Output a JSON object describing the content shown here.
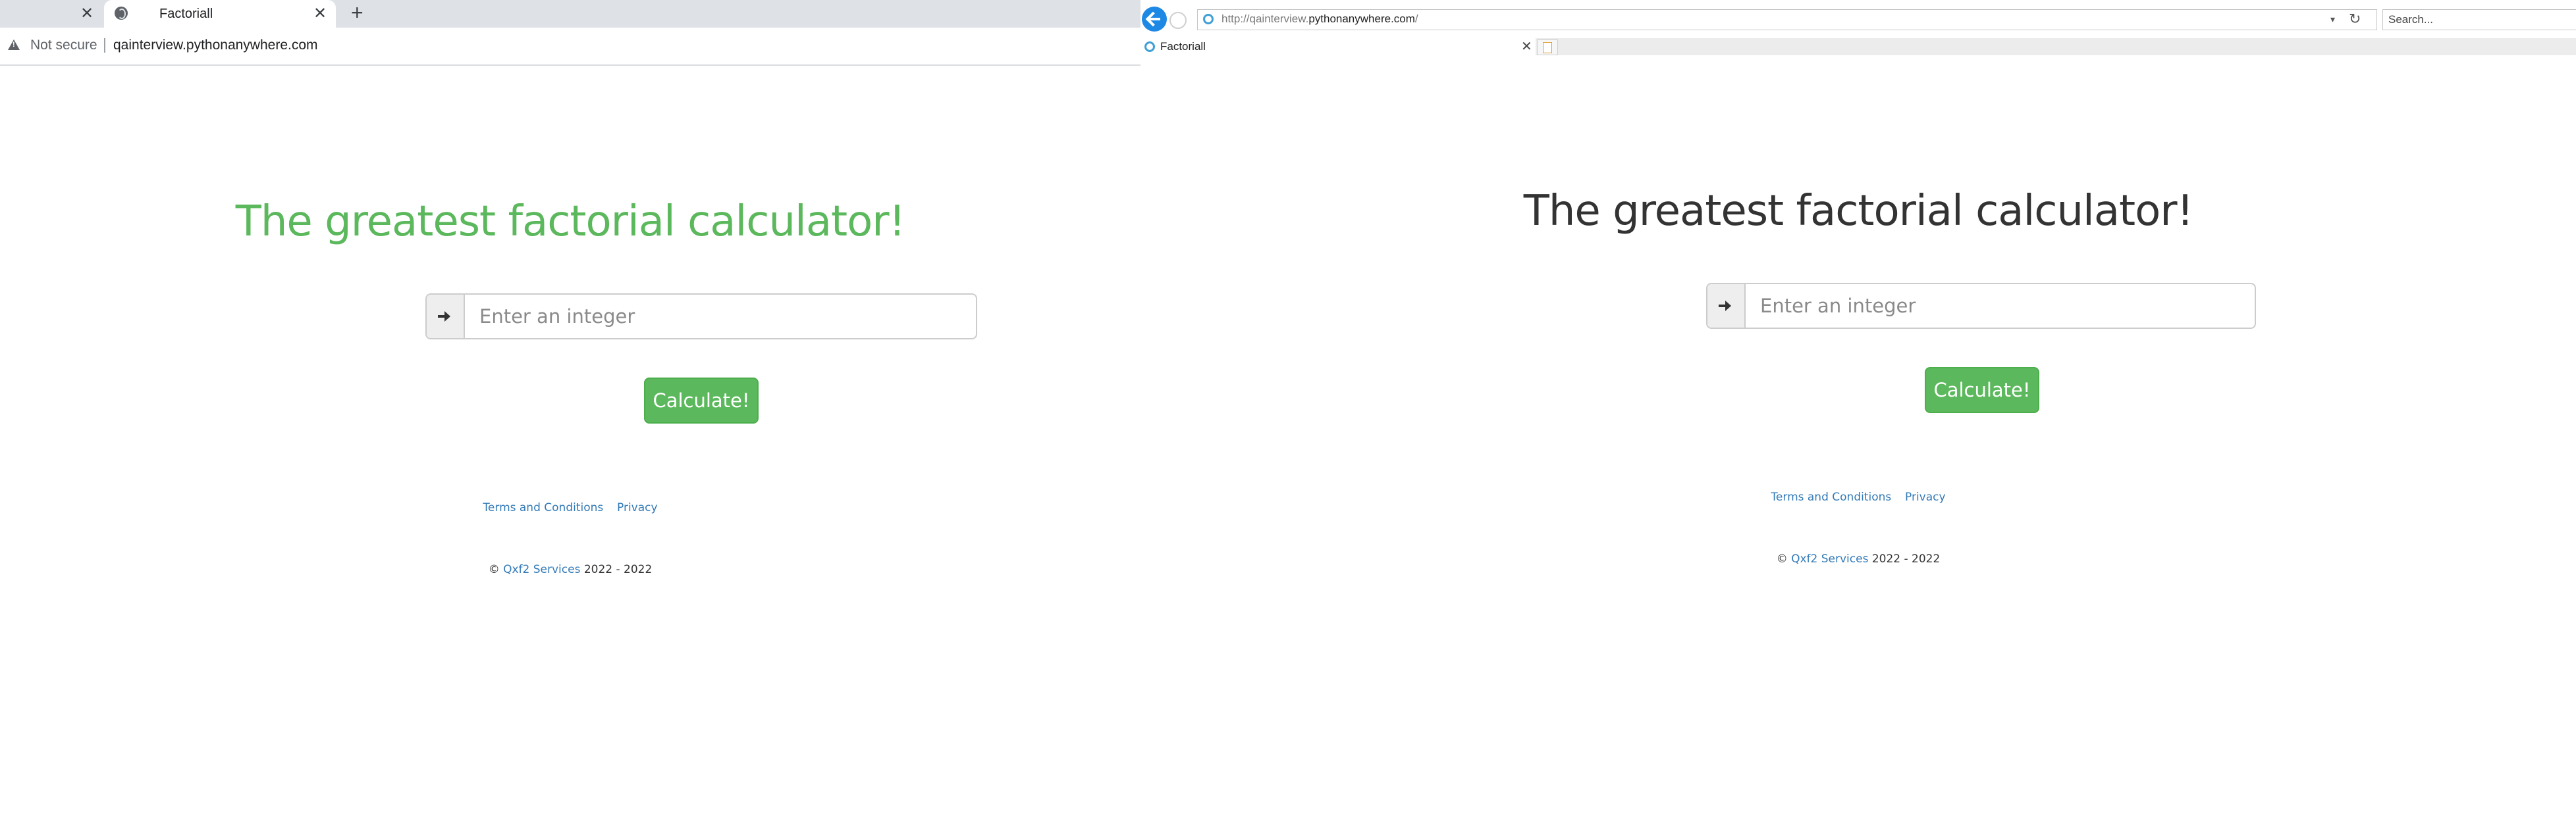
{
  "left_browser": {
    "tabs": [
      {
        "title": "",
        "active": false
      },
      {
        "title": "Factoriall",
        "active": true
      }
    ],
    "new_tab_symbol": "+",
    "close_symbol": "✕",
    "security_label": "Not secure",
    "url": "qainterview.pythonanywhere.com"
  },
  "right_browser": {
    "url_prefix": "http://qainterview.",
    "url_domain": "pythonanywhere.com",
    "url_suffix": "/",
    "search_placeholder": "Search...",
    "tab_title": "Factoriall",
    "close_symbol": "✕",
    "refresh_symbol": "↻",
    "dropdown_symbol": "▾"
  },
  "page": {
    "heading": "The greatest factorial calculator!",
    "input_placeholder": "Enter an integer",
    "input_value": "",
    "button_label": "Calculate!",
    "footer_links": [
      "Terms and Conditions",
      "Privacy"
    ],
    "copyright_prefix": "© ",
    "copyright_company": "Qxf2 Services",
    "copyright_years": " 2022 - 2022"
  },
  "colors": {
    "heading_left": "#5cb85c",
    "heading_right": "#333333",
    "button": "#5cb85c",
    "link": "#337ab7"
  },
  "icons": [
    "close-icon",
    "globe-icon",
    "plus-icon",
    "warning-icon",
    "back-icon",
    "forward-icon",
    "refresh-icon",
    "arrow-right-icon",
    "page-icon"
  ]
}
